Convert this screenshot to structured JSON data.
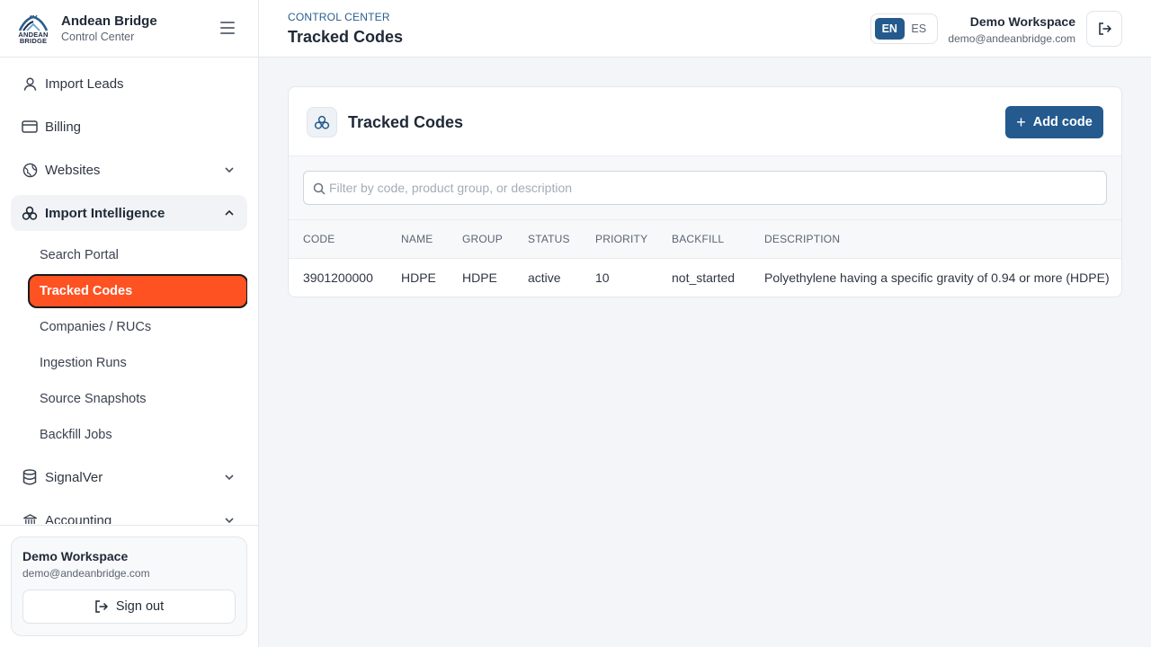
{
  "brand": {
    "name": "Andean Bridge",
    "subtitle": "Control Center",
    "logo_line1": "ANDEAN",
    "logo_line2": "BRIDGE"
  },
  "sidebar": {
    "items": [
      {
        "label": "Import Leads",
        "icon": "user-icon"
      },
      {
        "label": "Billing",
        "icon": "credit-card-icon"
      },
      {
        "label": "Websites",
        "icon": "globe-icon"
      },
      {
        "label": "Import Intelligence",
        "icon": "hexagon-cluster-icon"
      }
    ],
    "sub_items": [
      {
        "label": "Search Portal"
      },
      {
        "label": "Tracked Codes"
      },
      {
        "label": "Companies / RUCs"
      },
      {
        "label": "Ingestion Runs"
      },
      {
        "label": "Source Snapshots"
      },
      {
        "label": "Backfill Jobs"
      }
    ],
    "after_items": [
      {
        "label": "SignalVer",
        "icon": "database-icon"
      },
      {
        "label": "Accounting",
        "icon": "bank-icon"
      }
    ],
    "account": {
      "name": "Demo Workspace",
      "email": "demo@andeanbridge.com",
      "signout_label": "Sign out"
    }
  },
  "header": {
    "breadcrumb": "CONTROL CENTER",
    "title": "Tracked Codes",
    "lang_options": [
      "EN",
      "ES"
    ],
    "lang_selected": "EN",
    "workspace_name": "Demo Workspace",
    "workspace_email": "demo@andeanbridge.com"
  },
  "card": {
    "title": "Tracked Codes",
    "add_label": "Add code",
    "filter_placeholder": "Filter by code, product group, or description",
    "filter_value": "",
    "columns": [
      "CODE",
      "NAME",
      "GROUP",
      "STATUS",
      "PRIORITY",
      "BACKFILL",
      "DESCRIPTION"
    ],
    "rows": [
      {
        "code": "3901200000",
        "name": "HDPE",
        "group": "HDPE",
        "status": "active",
        "priority": "10",
        "backfill": "not_started",
        "description": "Polyethylene having a specific gravity of 0.94 or more (HDPE)"
      }
    ]
  },
  "colors": {
    "accent": "#245a8d",
    "active_nav": "#ff5222",
    "background": "#f3f5f8"
  }
}
